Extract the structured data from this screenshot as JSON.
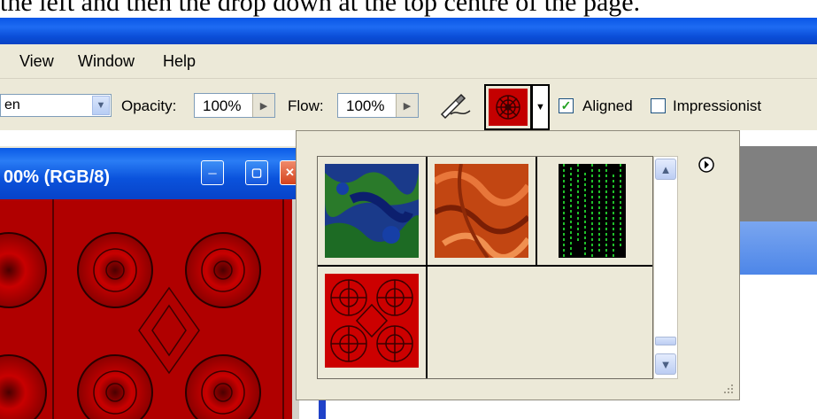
{
  "caption": "the left and then the drop down at the top centre of the page.",
  "menu": {
    "view": "View",
    "window": "Window",
    "help": "Help"
  },
  "options": {
    "mode_value": "en",
    "opacity_label": "Opacity:",
    "opacity_value": "100%",
    "flow_label": "Flow:",
    "flow_value": "100%",
    "aligned_label": "Aligned",
    "aligned_checked": true,
    "impressionist_label": "Impressionist",
    "impressionist_checked": false
  },
  "document": {
    "title": "00% (RGB/8)"
  },
  "pattern_picker": {
    "patterns": [
      {
        "name": "blue-green-texture"
      },
      {
        "name": "orange-marble"
      },
      {
        "name": "green-matrix"
      },
      {
        "name": "red-ornament"
      }
    ],
    "selected_pattern": "red-ornament"
  },
  "icons": {
    "menu_arrow": "play-circle-icon",
    "airbrush": "airbrush-icon",
    "scroll_up": "chevron-up-icon",
    "scroll_down": "chevron-down-icon"
  },
  "colors": {
    "xp_title_blue": "#0a56e6",
    "chrome": "#ece9d8",
    "pattern_red": "#b70000"
  }
}
